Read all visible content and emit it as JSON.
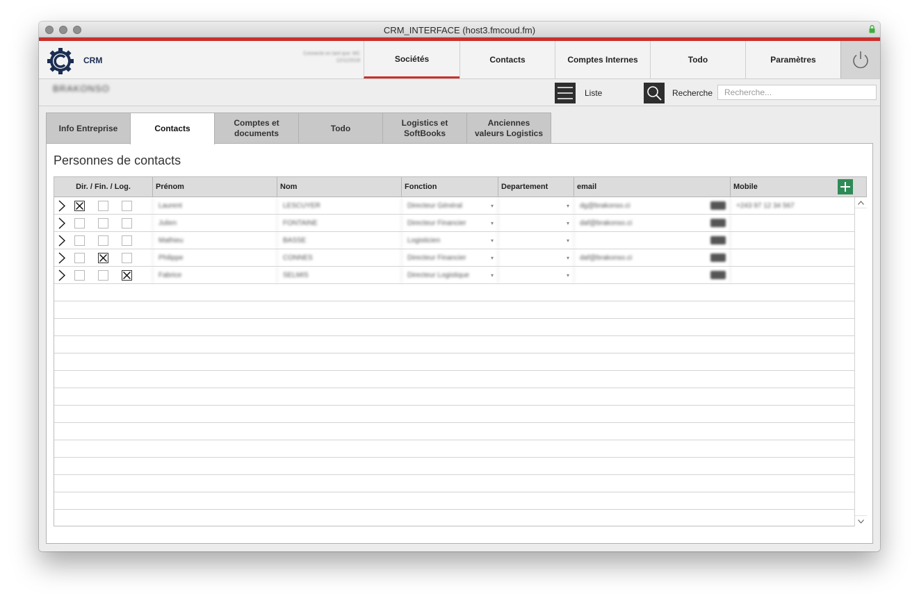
{
  "window": {
    "title": "CRM_INTERFACE (host3.fmcoud.fm)"
  },
  "header": {
    "brand": "CRM",
    "user_info": [
      "Connecté en tant que: MC",
      "12/11/2018"
    ],
    "nav": [
      {
        "label": "Sociétés",
        "active": true
      },
      {
        "label": "Contacts",
        "active": false
      },
      {
        "label": "Comptes Internes",
        "active": false
      },
      {
        "label": "Todo",
        "active": false
      },
      {
        "label": "Paramètres",
        "active": false
      }
    ]
  },
  "subheader": {
    "company_name": "BRAKONSO",
    "list_label": "Liste",
    "search_label": "Recherche",
    "search_placeholder": "Recherche..."
  },
  "tabs": [
    {
      "label": "Info Entreprise",
      "active": false
    },
    {
      "label": "Contacts",
      "active": true
    },
    {
      "label": "Comptes et\ndocuments",
      "active": false
    },
    {
      "label": "Todo",
      "active": false
    },
    {
      "label": "Logistics et\nSoftBooks",
      "active": false
    },
    {
      "label": "Anciennes\nvaleurs Logistics",
      "active": false
    }
  ],
  "section": {
    "title": "Personnes de contacts",
    "columns": {
      "flags": "Dir. / Fin. / Log.",
      "prenom": "Prénom",
      "nom": "Nom",
      "fonction": "Fonction",
      "departement": "Departement",
      "email": "email",
      "mobile": "Mobile"
    },
    "rows": [
      {
        "dir": true,
        "fin": false,
        "log": false,
        "prenom": "Laurent",
        "nom": "LESCUYER",
        "fonction": "Directeur Général",
        "departement": "",
        "email": "dg@brakonso.ci",
        "mobile": "+243 97 12 34 567"
      },
      {
        "dir": false,
        "fin": false,
        "log": false,
        "prenom": "Julien",
        "nom": "FONTAINE",
        "fonction": "Directeur Financier",
        "departement": "",
        "email": "daf@brakonso.ci",
        "mobile": ""
      },
      {
        "dir": false,
        "fin": false,
        "log": false,
        "prenom": "Mathieu",
        "nom": "BASSE",
        "fonction": "Logisticien",
        "departement": "",
        "email": "",
        "mobile": ""
      },
      {
        "dir": false,
        "fin": true,
        "log": false,
        "prenom": "Philippe",
        "nom": "CONNES",
        "fonction": "Directeur Financier",
        "departement": "",
        "email": "daf@brakonso.ci",
        "mobile": ""
      },
      {
        "dir": false,
        "fin": false,
        "log": true,
        "prenom": "Fabrice",
        "nom": "SELMIS",
        "fonction": "Directeur Logistique",
        "departement": "",
        "email": "",
        "mobile": ""
      }
    ],
    "empty_rows": 14
  }
}
